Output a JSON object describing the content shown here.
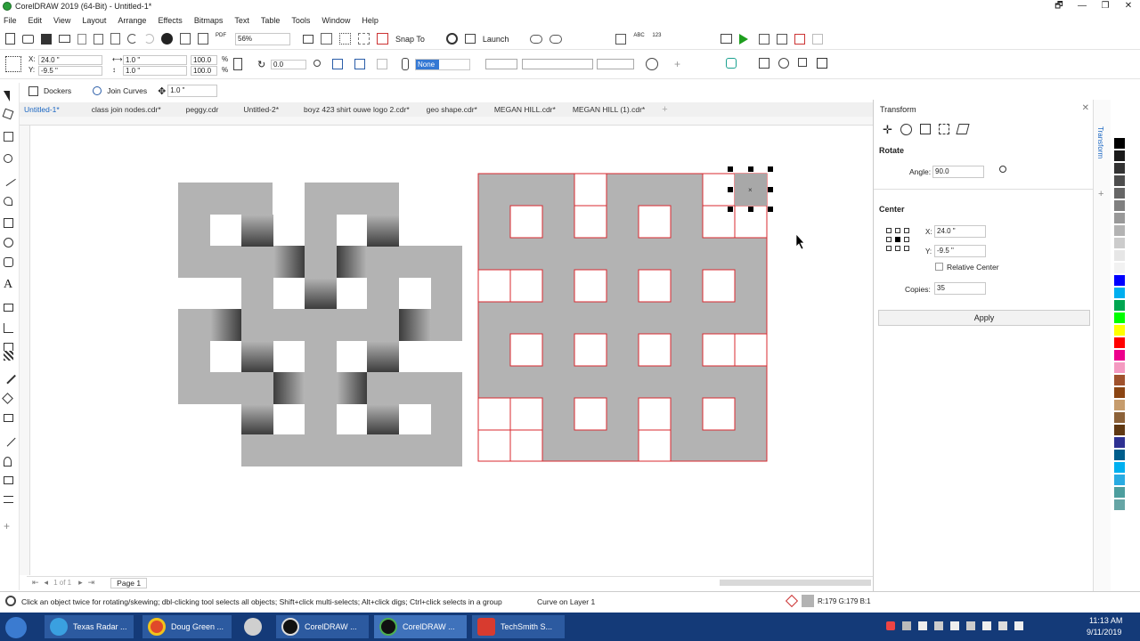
{
  "window": {
    "title": "CorelDRAW 2019 (64-Bit) - Untitled-1*",
    "controls": [
      "🗗",
      "—",
      "❐",
      "✕"
    ]
  },
  "menu": [
    "File",
    "Edit",
    "View",
    "Layout",
    "Arrange",
    "Effects",
    "Bitmaps",
    "Text",
    "Table",
    "Tools",
    "Window",
    "Help"
  ],
  "toolbar1": {
    "zoom": "56%",
    "snap_to": "Snap To",
    "launch": "Launch"
  },
  "property_bar": {
    "x": "24.0 \"",
    "y": "-9.5 \"",
    "w": "1.0 \"",
    "h": "1.0 \"",
    "sx": "100.0",
    "sy": "100.0",
    "pct1": "%",
    "pct2": "%",
    "angle": "0.0",
    "outline": "None"
  },
  "toolbar3": {
    "dockers": "Dockers",
    "join_curves": "Join Curves",
    "dist": "1.0 \""
  },
  "doc_tabs": [
    "Untitled-1*",
    "class join nodes.cdr*",
    "peggy.cdr",
    "Untitled-2*",
    "boyz 423 shirt ouwe logo 2.cdr*",
    "geo shape.cdr*",
    "MEGAN HILL.cdr*",
    "MEGAN HILL (1).cdr*"
  ],
  "transform": {
    "title": "Transform",
    "section_rotate": "Rotate",
    "angle_label": "Angle:",
    "angle": "90.0",
    "section_center": "Center",
    "x_label": "X:",
    "x": "24.0 \"",
    "y_label": "Y:",
    "y": "-9.5 \"",
    "relative_center": "Relative Center",
    "copies_label": "Copies:",
    "copies": "35",
    "apply": "Apply",
    "side_tab": "Transform"
  },
  "pagebar": {
    "page_of": "1  of  1",
    "page_tab": "Page 1"
  },
  "status": {
    "hint": "Click an object twice for rotating/skewing; dbl-clicking tool selects all objects; Shift+click multi-selects; Alt+click digs; Ctrl+click selects in a group",
    "layer": "Curve on Layer 1",
    "color": "R:179 G:179 B:1"
  },
  "taskbar": {
    "items": [
      "Texas Radar ...",
      "Doug Green ...",
      "CorelDRAW ...",
      "CorelDRAW ...",
      "TechSmith S..."
    ],
    "time": "11:13 AM",
    "date": "9/11/2019"
  },
  "colors": {
    "accent": "#1a66c2",
    "shape_gray": "#b3b3b3",
    "outline_red": "#d8292f",
    "taskbar": "#143a78"
  },
  "palette": [
    "#ffffff",
    "#000000",
    "#1a1a1a",
    "#333333",
    "#4d4d4d",
    "#666666",
    "#808080",
    "#999999",
    "#b3b3b3",
    "#cccccc",
    "#e6e6e6",
    "#f2f2f2",
    "#0000ff",
    "#00aeef",
    "#00a651",
    "#00ff00",
    "#ffff00",
    "#ff0000",
    "#ed008c",
    "#f49ac1",
    "#a0522d",
    "#8b4513",
    "#c69c6d",
    "#8c6239",
    "#603913",
    "#2e3192",
    "#005e8c",
    "#00b0f0",
    "#29abe2",
    "#4d9e9e",
    "#66a5a5"
  ]
}
